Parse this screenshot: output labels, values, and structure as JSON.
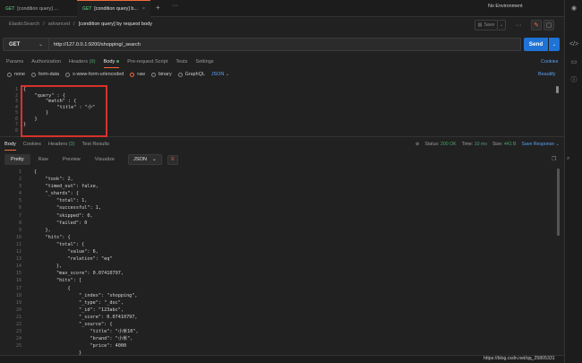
{
  "tabs": [
    {
      "method": "GET",
      "label": "[condition query] ..."
    },
    {
      "method": "GET",
      "label": "[condition query] b..."
    }
  ],
  "environment": "No Environment",
  "breadcrumb": {
    "root": "ElasticSearch",
    "folder": "advanced",
    "current": "[condition query] by request body"
  },
  "save_label": "Save",
  "request": {
    "method": "GET",
    "url": "http://127.0.0.1:9200/shopping/_search",
    "send_label": "Send"
  },
  "req_tabs": {
    "params": "Params",
    "authorization": "Authorization",
    "headers": "Headers",
    "headers_count": "(9)",
    "body": "Body",
    "prerequest": "Pre-request Script",
    "tests": "Tests",
    "settings": "Settings",
    "cookies": "Cookies"
  },
  "body_types": {
    "none": "none",
    "form_data": "form-data",
    "urlencoded": "x-www-form-urlencoded",
    "raw": "raw",
    "binary": "binary",
    "graphql": "GraphQL",
    "format": "JSON",
    "beautify": "Beautify"
  },
  "request_body": {
    "gutter": "1\n2\n3\n4\n5\n6\n7\n8",
    "code": "{\n    \"query\" : {\n        \"match\" : {\n            \"title\" : \"小\"\n        }\n    }\n}\n"
  },
  "response": {
    "tabs": {
      "body": "Body",
      "cookies": "Cookies",
      "headers": "Headers",
      "headers_count": "(3)",
      "test_results": "Test Results"
    },
    "status_label": "Status:",
    "status_value": "200 OK",
    "time_label": "Time:",
    "time_value": "10 ms",
    "size_label": "Size:",
    "size_value": "441 B",
    "save_response": "Save Response",
    "views": {
      "pretty": "Pretty",
      "raw": "Raw",
      "preview": "Preview",
      "visualize": "Visualize",
      "format": "JSON"
    },
    "gutter": "1\n2\n3\n4\n5\n6\n7\n8\n9\n10\n11\n12\n13\n14\n15\n16\n17\n18\n19\n20\n21\n22\n23\n24\n25",
    "code": "{\n    \"took\": 2,\n    \"timed_out\": false,\n    \"_shards\": {\n        \"total\": 1,\n        \"successful\": 1,\n        \"skipped\": 0,\n        \"failed\": 0\n    },\n    \"hits\": {\n        \"total\": {\n            \"value\": 6,\n            \"relation\": \"eq\"\n        },\n        \"max_score\": 0.07410797,\n        \"hits\": [\n            {\n                \"_index\": \"shopping\",\n                \"_type\": \"_doc\",\n                \"_id\": \"123abc\",\n                \"_score\": 0.07410797,\n                \"_source\": {\n                    \"title\": \"小米10\",\n                    \"brand\": \"小米\",\n                    \"price\": 4000\n                }"
  },
  "watermark": "https://blog.csdn.net/qq_25805331",
  "colors": {
    "accent": "#f26b3a",
    "send": "#1f72d6",
    "highlight_box": "#d8322b",
    "ok": "#49a56b"
  }
}
